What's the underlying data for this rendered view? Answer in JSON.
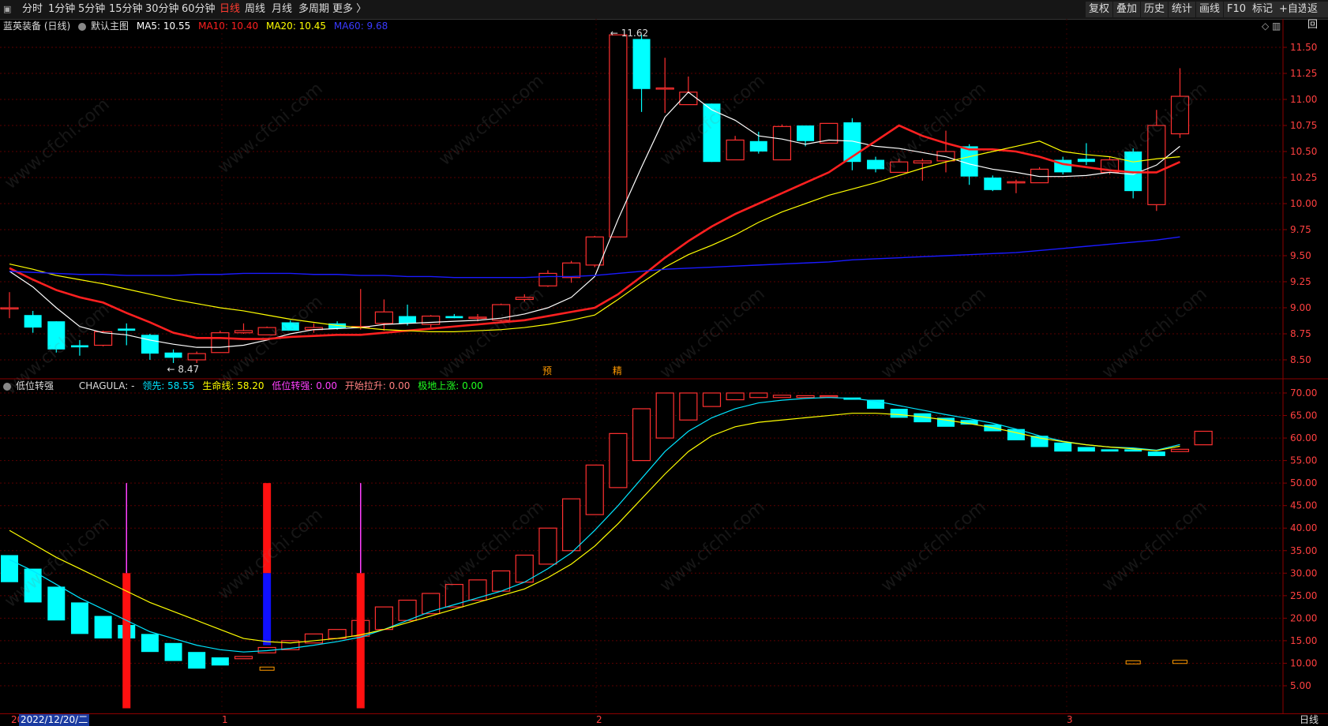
{
  "toolbar": {
    "menu_icon": "square-menu-icon",
    "periods": [
      "分时",
      "1分钟",
      "5分钟",
      "15分钟",
      "30分钟",
      "60分钟",
      "日线",
      "周线",
      "月线",
      "多周期",
      "更多 〉"
    ],
    "active_period": "日线",
    "right_buttons": [
      "复权",
      "叠加",
      "历史",
      "统计",
      "画线",
      "F10",
      "标记",
      "+自选",
      "返回"
    ]
  },
  "main_legend": {
    "stock_name": "蓝英装备 (日线)",
    "settings_icon": "circle-settings-icon",
    "template": "默认主图",
    "ma5": "MA5: 10.55",
    "ma10": "MA10: 10.40",
    "ma20": "MA20: 10.45",
    "ma60": "MA60: 9.68",
    "ma_colors": {
      "ma5": "#ffffff",
      "ma10": "#ff2020",
      "ma20": "#ffff00",
      "ma60": "#2020ff"
    },
    "diamond_icon": "diamond-icon"
  },
  "sub_legend": {
    "name": "低位转强",
    "chagula": "CHAGULA: -",
    "lead": "领先: 58.55",
    "life": "生命线: 58.20",
    "low_strong": "低位转强: 0.00",
    "start_pull": "开始拉升: 0.00",
    "ground_rise": "极地上涨: 0.00"
  },
  "bottom": {
    "start_marker": "20",
    "date_label": "2022/12/20/二",
    "month_markers": [
      "1",
      "2",
      "3"
    ],
    "right_label": "日线"
  },
  "watermark": "www.cfchi.com",
  "chart_data": [
    {
      "type": "candlestick",
      "title": "蓝英装备 (日线)",
      "ylim": [
        8.4,
        11.7
      ],
      "y_ticks": [
        "11.50",
        "11.25",
        "11.00",
        "10.75",
        "10.50",
        "10.25",
        "10.00",
        "9.75",
        "9.50",
        "9.25",
        "9.00",
        "8.75",
        "8.50"
      ],
      "colors": {
        "up": "#ff3030",
        "down": "#00ffff"
      },
      "candles": [
        {
          "o": 9.0,
          "h": 9.15,
          "l": 8.9,
          "c": 9.0
        },
        {
          "o": 8.93,
          "h": 8.97,
          "l": 8.76,
          "c": 8.81
        },
        {
          "o": 8.87,
          "h": 8.87,
          "l": 8.57,
          "c": 8.6
        },
        {
          "o": 8.64,
          "h": 8.69,
          "l": 8.54,
          "c": 8.62
        },
        {
          "o": 8.64,
          "h": 8.78,
          "l": 8.63,
          "c": 8.77
        },
        {
          "o": 8.8,
          "h": 8.85,
          "l": 8.64,
          "c": 8.78
        },
        {
          "o": 8.74,
          "h": 8.75,
          "l": 8.5,
          "c": 8.56
        },
        {
          "o": 8.57,
          "h": 8.6,
          "l": 8.47,
          "c": 8.52
        },
        {
          "o": 8.5,
          "h": 8.58,
          "l": 8.47,
          "c": 8.56
        },
        {
          "o": 8.57,
          "h": 8.78,
          "l": 8.57,
          "c": 8.76
        },
        {
          "o": 8.76,
          "h": 8.85,
          "l": 8.75,
          "c": 8.78
        },
        {
          "o": 8.74,
          "h": 8.82,
          "l": 8.74,
          "c": 8.81
        },
        {
          "o": 8.86,
          "h": 8.88,
          "l": 8.78,
          "c": 8.78
        },
        {
          "o": 8.79,
          "h": 8.85,
          "l": 8.76,
          "c": 8.81
        },
        {
          "o": 8.85,
          "h": 8.87,
          "l": 8.79,
          "c": 8.8
        },
        {
          "o": 8.81,
          "h": 9.18,
          "l": 8.79,
          "c": 8.82
        },
        {
          "o": 8.85,
          "h": 9.08,
          "l": 8.78,
          "c": 8.96
        },
        {
          "o": 8.92,
          "h": 9.03,
          "l": 8.83,
          "c": 8.85
        },
        {
          "o": 8.84,
          "h": 8.93,
          "l": 8.81,
          "c": 8.92
        },
        {
          "o": 8.92,
          "h": 8.94,
          "l": 8.9,
          "c": 8.9
        },
        {
          "o": 8.9,
          "h": 8.94,
          "l": 8.87,
          "c": 8.91
        },
        {
          "o": 8.88,
          "h": 9.04,
          "l": 8.87,
          "c": 9.03
        },
        {
          "o": 9.08,
          "h": 9.13,
          "l": 9.06,
          "c": 9.1
        },
        {
          "o": 9.21,
          "h": 9.36,
          "l": 9.2,
          "c": 9.33
        },
        {
          "o": 9.29,
          "h": 9.45,
          "l": 9.24,
          "c": 9.43
        },
        {
          "o": 9.41,
          "h": 9.69,
          "l": 9.39,
          "c": 9.68
        },
        {
          "o": 9.68,
          "h": 11.62,
          "l": 9.68,
          "c": 11.62
        },
        {
          "o": 11.58,
          "h": 11.62,
          "l": 10.88,
          "c": 11.1
        },
        {
          "o": 11.1,
          "h": 11.4,
          "l": 10.87,
          "c": 11.11
        },
        {
          "o": 10.95,
          "h": 11.22,
          "l": 10.95,
          "c": 11.07
        },
        {
          "o": 10.96,
          "h": 10.96,
          "l": 10.4,
          "c": 10.4
        },
        {
          "o": 10.42,
          "h": 10.65,
          "l": 10.42,
          "c": 10.61
        },
        {
          "o": 10.6,
          "h": 10.69,
          "l": 10.48,
          "c": 10.5
        },
        {
          "o": 10.42,
          "h": 10.76,
          "l": 10.42,
          "c": 10.74
        },
        {
          "o": 10.75,
          "h": 10.75,
          "l": 10.55,
          "c": 10.6
        },
        {
          "o": 10.58,
          "h": 10.77,
          "l": 10.58,
          "c": 10.77
        },
        {
          "o": 10.78,
          "h": 10.82,
          "l": 10.32,
          "c": 10.4
        },
        {
          "o": 10.42,
          "h": 10.45,
          "l": 10.3,
          "c": 10.33
        },
        {
          "o": 10.3,
          "h": 10.43,
          "l": 10.3,
          "c": 10.4
        },
        {
          "o": 10.39,
          "h": 10.43,
          "l": 10.22,
          "c": 10.41
        },
        {
          "o": 10.41,
          "h": 10.7,
          "l": 10.3,
          "c": 10.5
        },
        {
          "o": 10.55,
          "h": 10.57,
          "l": 10.18,
          "c": 10.26
        },
        {
          "o": 10.25,
          "h": 10.27,
          "l": 10.12,
          "c": 10.13
        },
        {
          "o": 10.2,
          "h": 10.23,
          "l": 10.1,
          "c": 10.21
        },
        {
          "o": 10.2,
          "h": 10.35,
          "l": 10.2,
          "c": 10.33
        },
        {
          "o": 10.42,
          "h": 10.45,
          "l": 10.28,
          "c": 10.3
        },
        {
          "o": 10.43,
          "h": 10.58,
          "l": 10.37,
          "c": 10.4
        },
        {
          "o": 10.3,
          "h": 10.45,
          "l": 10.28,
          "c": 10.42
        },
        {
          "o": 10.5,
          "h": 10.53,
          "l": 10.05,
          "c": 10.12
        },
        {
          "o": 9.99,
          "h": 10.9,
          "l": 9.93,
          "c": 10.75
        },
        {
          "o": 10.67,
          "h": 11.3,
          "l": 10.63,
          "c": 11.03
        }
      ],
      "series": [
        {
          "name": "MA5",
          "values": [
            9.35,
            9.2,
            9.0,
            8.82,
            8.76,
            8.74,
            8.69,
            8.65,
            8.62,
            8.62,
            8.64,
            8.69,
            8.75,
            8.79,
            8.8,
            8.81,
            8.84,
            8.85,
            8.86,
            8.87,
            8.88,
            8.9,
            8.94,
            9.0,
            9.1,
            9.3,
            9.85,
            10.35,
            10.83,
            11.07,
            10.9,
            10.8,
            10.65,
            10.62,
            10.57,
            10.61,
            10.6,
            10.55,
            10.53,
            10.49,
            10.45,
            10.38,
            10.33,
            10.3,
            10.26,
            10.26,
            10.27,
            10.3,
            10.28,
            10.37,
            10.55
          ]
        },
        {
          "name": "MA10",
          "values": [
            9.38,
            9.27,
            9.17,
            9.1,
            9.05,
            8.95,
            8.86,
            8.76,
            8.71,
            8.71,
            8.7,
            8.7,
            8.72,
            8.73,
            8.74,
            8.74,
            8.76,
            8.78,
            8.8,
            8.82,
            8.84,
            8.86,
            8.88,
            8.92,
            8.96,
            9.0,
            9.13,
            9.3,
            9.48,
            9.64,
            9.78,
            9.9,
            10.0,
            10.1,
            10.2,
            10.3,
            10.45,
            10.6,
            10.75,
            10.65,
            10.58,
            10.52,
            10.52,
            10.5,
            10.45,
            10.38,
            10.35,
            10.32,
            10.3,
            10.3,
            10.4
          ]
        },
        {
          "name": "MA20",
          "values": [
            9.42,
            9.37,
            9.31,
            9.27,
            9.23,
            9.18,
            9.13,
            9.08,
            9.04,
            9.0,
            8.97,
            8.93,
            8.89,
            8.86,
            8.83,
            8.81,
            8.79,
            8.78,
            8.77,
            8.77,
            8.78,
            8.79,
            8.81,
            8.84,
            8.88,
            8.93,
            9.08,
            9.24,
            9.39,
            9.51,
            9.6,
            9.7,
            9.82,
            9.92,
            10.0,
            10.08,
            10.14,
            10.2,
            10.27,
            10.34,
            10.4,
            10.45,
            10.5,
            10.55,
            10.6,
            10.5,
            10.47,
            10.45,
            10.4,
            10.43,
            10.45
          ]
        },
        {
          "name": "MA60",
          "values": [
            9.35,
            9.34,
            9.33,
            9.32,
            9.32,
            9.31,
            9.31,
            9.31,
            9.32,
            9.32,
            9.33,
            9.33,
            9.33,
            9.32,
            9.32,
            9.31,
            9.31,
            9.3,
            9.3,
            9.29,
            9.29,
            9.29,
            9.29,
            9.3,
            9.3,
            9.31,
            9.33,
            9.35,
            9.37,
            9.38,
            9.39,
            9.4,
            9.41,
            9.42,
            9.43,
            9.44,
            9.46,
            9.47,
            9.48,
            9.49,
            9.5,
            9.51,
            9.52,
            9.53,
            9.55,
            9.57,
            9.59,
            9.61,
            9.63,
            9.65,
            9.68
          ]
        }
      ],
      "annotations": [
        {
          "text": "8.47",
          "index": 7,
          "value": 8.47
        },
        {
          "text": "11.62",
          "index": 26,
          "value": 11.62
        },
        {
          "text": "预",
          "index": 23
        },
        {
          "text": "精",
          "index": 26
        }
      ]
    },
    {
      "type": "candlestick",
      "title": "低位转强",
      "ylim": [
        0,
        72
      ],
      "y_ticks": [
        "70.00",
        "65.00",
        "60.00",
        "55.00",
        "50.00",
        "45.00",
        "40.00",
        "35.00",
        "30.00",
        "25.00",
        "20.00",
        "15.00",
        "10.00",
        "5.00"
      ],
      "candles": [
        {
          "o": 34,
          "c": 28,
          "dir": "down"
        },
        {
          "o": 31,
          "c": 23.5,
          "dir": "down"
        },
        {
          "o": 27,
          "c": 19.5,
          "dir": "down"
        },
        {
          "o": 23.5,
          "c": 16.5,
          "dir": "down"
        },
        {
          "o": 20.5,
          "c": 15.5,
          "dir": "down"
        },
        {
          "o": 18.5,
          "c": 15.5,
          "dir": "down"
        },
        {
          "o": 16.5,
          "c": 12.5,
          "dir": "down"
        },
        {
          "o": 14.5,
          "c": 10.5,
          "dir": "down"
        },
        {
          "o": 12.5,
          "c": 8.8,
          "dir": "down"
        },
        {
          "o": 11.3,
          "c": 9.5,
          "dir": "down"
        },
        {
          "o": 11.0,
          "c": 11.5,
          "dir": "up"
        },
        {
          "o": 12.3,
          "c": 13.5,
          "dir": "up"
        },
        {
          "o": 13.0,
          "c": 15.0,
          "dir": "up"
        },
        {
          "o": 14.5,
          "c": 16.5,
          "dir": "up"
        },
        {
          "o": 15.5,
          "c": 17.5,
          "dir": "up"
        },
        {
          "o": 16.0,
          "c": 19.5,
          "dir": "up"
        },
        {
          "o": 17.5,
          "c": 22.5,
          "dir": "up"
        },
        {
          "o": 19.5,
          "c": 24.0,
          "dir": "up"
        },
        {
          "o": 21.0,
          "c": 25.5,
          "dir": "up"
        },
        {
          "o": 22.5,
          "c": 27.5,
          "dir": "up"
        },
        {
          "o": 24.0,
          "c": 28.5,
          "dir": "up"
        },
        {
          "o": 26.0,
          "c": 30.5,
          "dir": "up"
        },
        {
          "o": 28.0,
          "c": 34.0,
          "dir": "up"
        },
        {
          "o": 32.0,
          "c": 40.0,
          "dir": "up"
        },
        {
          "o": 35.0,
          "c": 46.5,
          "dir": "up"
        },
        {
          "o": 43.0,
          "c": 54.0,
          "dir": "up"
        },
        {
          "o": 49.0,
          "c": 61.0,
          "dir": "up"
        },
        {
          "o": 55.0,
          "c": 66.5,
          "dir": "up"
        },
        {
          "o": 60.0,
          "c": 70.0,
          "dir": "up"
        },
        {
          "o": 64.0,
          "c": 70.0,
          "dir": "up"
        },
        {
          "o": 67.0,
          "c": 70.0,
          "dir": "up"
        },
        {
          "o": 68.5,
          "c": 70.0,
          "dir": "up"
        },
        {
          "o": 69.0,
          "c": 70.0,
          "dir": "up"
        },
        {
          "o": 69.0,
          "c": 69.5,
          "dir": "up"
        },
        {
          "o": 69.0,
          "c": 69.4,
          "dir": "up"
        },
        {
          "o": 69.2,
          "c": 69.4,
          "dir": "up"
        },
        {
          "o": 69.0,
          "c": 68.5,
          "dir": "down"
        },
        {
          "o": 68.5,
          "c": 66.5,
          "dir": "down"
        },
        {
          "o": 66.5,
          "c": 64.5,
          "dir": "down"
        },
        {
          "o": 65.5,
          "c": 63.5,
          "dir": "down"
        },
        {
          "o": 64.5,
          "c": 62.5,
          "dir": "down"
        },
        {
          "o": 64.0,
          "c": 63.0,
          "dir": "down"
        },
        {
          "o": 63.0,
          "c": 61.5,
          "dir": "down"
        },
        {
          "o": 62.0,
          "c": 59.5,
          "dir": "down"
        },
        {
          "o": 60.5,
          "c": 58.0,
          "dir": "down"
        },
        {
          "o": 59.0,
          "c": 57.0,
          "dir": "down"
        },
        {
          "o": 58.0,
          "c": 57.0,
          "dir": "down"
        },
        {
          "o": 57.5,
          "c": 57.0,
          "dir": "down"
        },
        {
          "o": 57.5,
          "c": 57.0,
          "dir": "down"
        },
        {
          "o": 57.0,
          "c": 56.0,
          "dir": "down"
        },
        {
          "o": 57.0,
          "c": 57.5,
          "dir": "up"
        },
        {
          "o": 58.5,
          "c": 61.5,
          "dir": "up"
        }
      ],
      "series": [
        {
          "name": "领先",
          "values": [
            33,
            30.5,
            27.5,
            24.5,
            22,
            19.5,
            17,
            15.5,
            14,
            13,
            12.5,
            12.8,
            13.3,
            14,
            14.8,
            15.8,
            17.5,
            19.5,
            21.5,
            23,
            24.5,
            26,
            28,
            31,
            34.5,
            39.5,
            45,
            51,
            57,
            61.5,
            64.5,
            66.5,
            67.8,
            68.4,
            68.8,
            69,
            68.8,
            68.2,
            67.2,
            66.2,
            65.2,
            64.3,
            63.3,
            62,
            60.5,
            59.3,
            58.5,
            58,
            57.8,
            57.3,
            58.55
          ]
        },
        {
          "name": "生命线",
          "values": [
            39.5,
            36.5,
            33.5,
            31,
            28.5,
            26,
            23.5,
            21.5,
            19.5,
            17.5,
            15.5,
            14.8,
            14.5,
            15,
            15.5,
            16.3,
            17.5,
            19,
            20.5,
            22,
            23.5,
            25,
            26.5,
            29,
            32,
            36,
            41,
            46.5,
            52,
            57,
            60.5,
            62.5,
            63.5,
            64,
            64.5,
            65,
            65.5,
            65.5,
            65.2,
            64.7,
            64,
            63.2,
            62.3,
            61.2,
            60,
            59.2,
            58.5,
            58,
            57.6,
            57.2,
            58.2
          ]
        }
      ],
      "signal_bars": [
        {
          "index": 5,
          "red": [
            0,
            30
          ],
          "magenta": [
            30,
            50
          ]
        },
        {
          "index": 11,
          "red": [
            30,
            50
          ],
          "blue": [
            14,
            30
          ]
        },
        {
          "index": 15,
          "red": [
            0,
            30
          ],
          "magenta": [
            30,
            50
          ]
        }
      ],
      "small_marks": [
        {
          "index": 11,
          "value": 8.8
        },
        {
          "index": 48,
          "value": 10.2
        },
        {
          "index": 50,
          "value": 10.3
        }
      ]
    }
  ]
}
